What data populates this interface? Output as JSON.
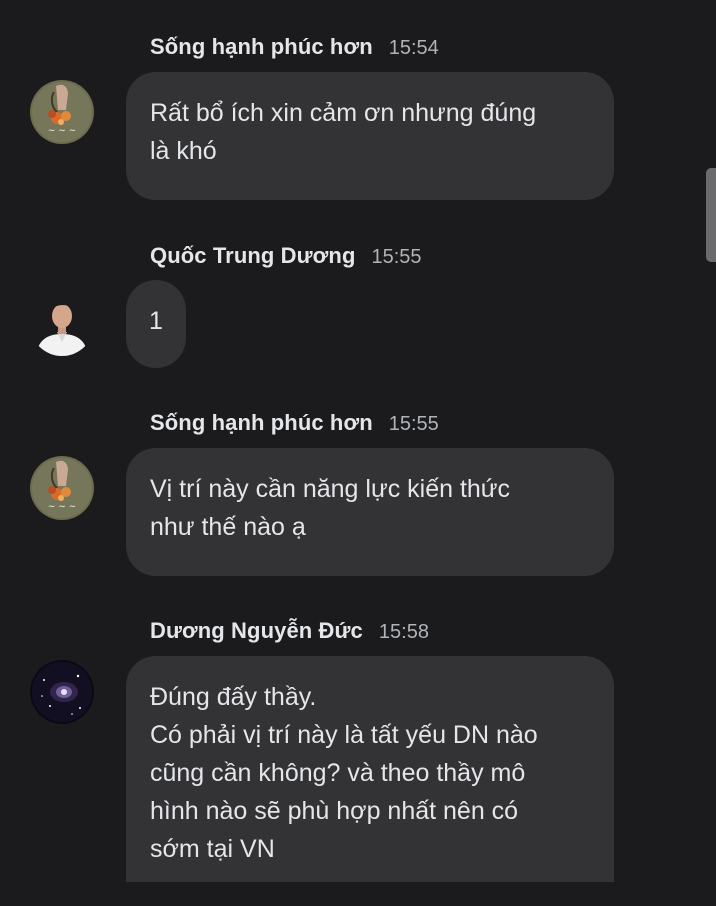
{
  "messages": [
    {
      "sender": "Sống hạnh phúc hơn",
      "time": "15:54",
      "avatar": "flower-bouquet-avatar",
      "lines": [
        "Rất bổ ích xin cảm ơn nhưng đúng",
        "là khó"
      ]
    },
    {
      "sender": "Quốc Trung Dương",
      "time": "15:55",
      "avatar": "man-portrait-avatar",
      "lines": [
        "1"
      ]
    },
    {
      "sender": "Sống hạnh phúc hơn",
      "time": "15:55",
      "avatar": "flower-bouquet-avatar",
      "lines": [
        "Vị trí này cần năng lực kiến thức",
        "như thế nào ạ"
      ]
    },
    {
      "sender": "Dương Nguyễn Đức",
      "time": "15:58",
      "avatar": "galaxy-avatar",
      "lines": [
        "Đúng đấy thầy.",
        "Có phải vị trí này là tất yếu DN nào",
        "cũng cần không? và theo thầy mô",
        "hình nào sẽ phù hợp nhất nên có",
        "sớm tại VN"
      ]
    }
  ],
  "colors": {
    "background": "#1b1b1d",
    "bubble": "#333336",
    "text": "#e4e6ea",
    "timestamp": "#b0b3b8"
  }
}
